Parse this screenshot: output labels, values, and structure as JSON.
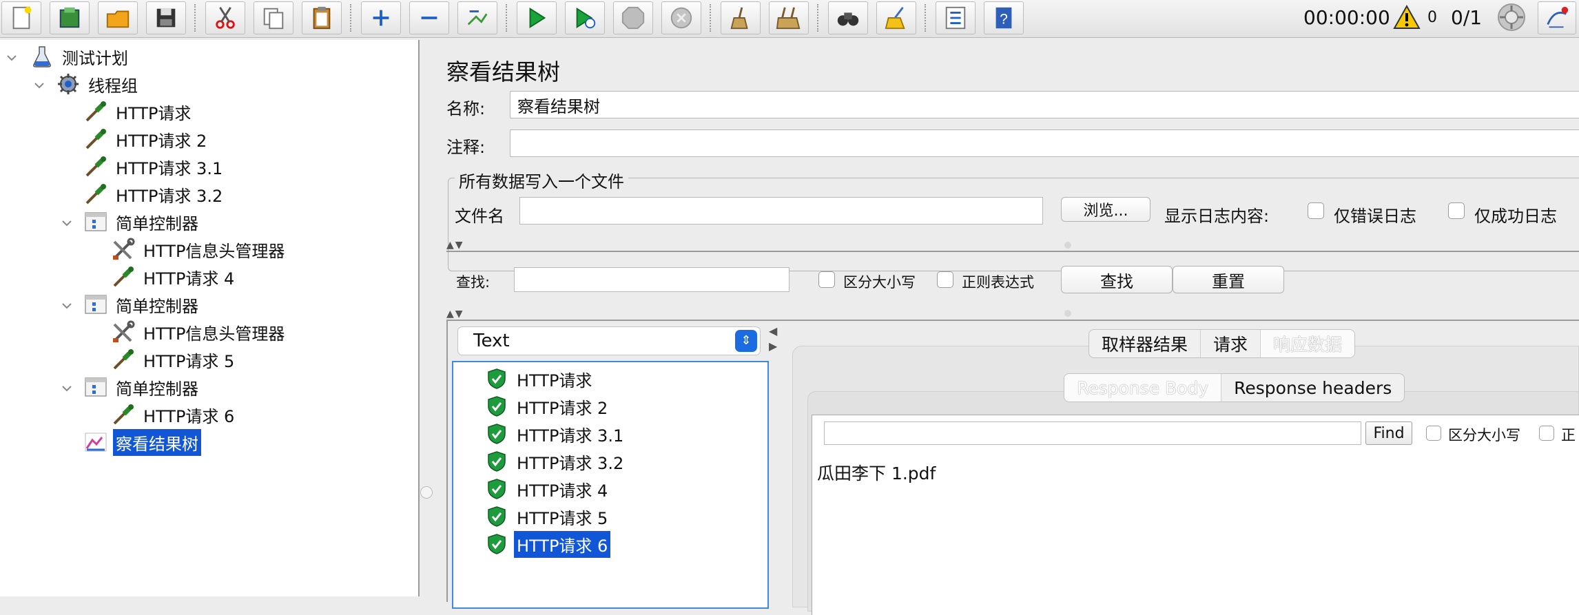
{
  "toolbar": {
    "buttons": [
      "new-icon",
      "templates-icon",
      "open-icon",
      "save-icon",
      "cut-icon",
      "copy-icon",
      "paste-icon",
      "expand-icon",
      "collapse-icon",
      "toggle-icon",
      "start-icon",
      "start-no-pause-icon",
      "stop-icon",
      "shutdown-icon",
      "clear-icon",
      "clear-all-icon",
      "search-icon",
      "reset-search-icon",
      "function-helper-icon",
      "help-icon"
    ],
    "timer": "00:00:00",
    "warning_count": "0",
    "threads": "0/1"
  },
  "tree": {
    "items": [
      {
        "label": "测试计划",
        "icon": "flask-icon",
        "level": 0,
        "expanded": true
      },
      {
        "label": "线程组",
        "icon": "gear-icon",
        "level": 1,
        "expanded": true
      },
      {
        "label": "HTTP请求",
        "icon": "pipette-icon",
        "level": 2
      },
      {
        "label": "HTTP请求 2",
        "icon": "pipette-icon",
        "level": 2
      },
      {
        "label": "HTTP请求 3.1",
        "icon": "pipette-icon",
        "level": 2
      },
      {
        "label": "HTTP请求 3.2",
        "icon": "pipette-icon",
        "level": 2
      },
      {
        "label": "简单控制器",
        "icon": "controller-icon",
        "level": 2,
        "expanded": true
      },
      {
        "label": "HTTP信息头管理器",
        "icon": "tools-icon",
        "level": 3
      },
      {
        "label": "HTTP请求 4",
        "icon": "pipette-icon",
        "level": 3
      },
      {
        "label": "简单控制器",
        "icon": "controller-icon",
        "level": 2,
        "expanded": true
      },
      {
        "label": "HTTP信息头管理器",
        "icon": "tools-icon",
        "level": 3
      },
      {
        "label": "HTTP请求 5",
        "icon": "pipette-icon",
        "level": 3
      },
      {
        "label": "简单控制器",
        "icon": "controller-icon",
        "level": 2,
        "expanded": true
      },
      {
        "label": "HTTP请求 6",
        "icon": "pipette-icon",
        "level": 3
      },
      {
        "label": "察看结果树",
        "icon": "chart-icon",
        "level": 2,
        "selected": true
      }
    ]
  },
  "panel": {
    "title": "察看结果树",
    "name_label": "名称:",
    "name_value": "察看结果树",
    "comment_label": "注释:",
    "comment_value": "",
    "file_group_title": "所有数据写入一个文件",
    "filename_label": "文件名",
    "filename_value": "",
    "browse_label": "浏览...",
    "log_label": "显示日志内容:",
    "errors_only_label": "仅错误日志",
    "success_only_label": "仅成功日志",
    "search_label": "查找:",
    "search_value": "",
    "case_sensitive_label": "区分大小写",
    "regex_label": "正则表达式",
    "find_label": "查找",
    "reset_label": "重置"
  },
  "results": {
    "renderer": "Text",
    "items": [
      {
        "label": "HTTP请求",
        "status": "success"
      },
      {
        "label": "HTTP请求 2",
        "status": "success"
      },
      {
        "label": "HTTP请求 3.1",
        "status": "success"
      },
      {
        "label": "HTTP请求 3.2",
        "status": "success"
      },
      {
        "label": "HTTP请求 4",
        "status": "success"
      },
      {
        "label": "HTTP请求 5",
        "status": "success"
      },
      {
        "label": "HTTP请求 6",
        "status": "success",
        "selected": true
      }
    ]
  },
  "detail": {
    "tabs": [
      "取样器结果",
      "请求",
      "响应数据"
    ],
    "active_tab": 2,
    "subtabs": [
      "Response Body",
      "Response headers"
    ],
    "active_subtab": 0,
    "find_value": "",
    "find_label": "Find",
    "case_label": "区分大小写",
    "cut_label": "正",
    "body_text": "瓜田李下  1.pdf"
  },
  "colors": {
    "selection": "#1156d6",
    "success": "#1e9b3c",
    "accent": "#1b6ce0"
  }
}
